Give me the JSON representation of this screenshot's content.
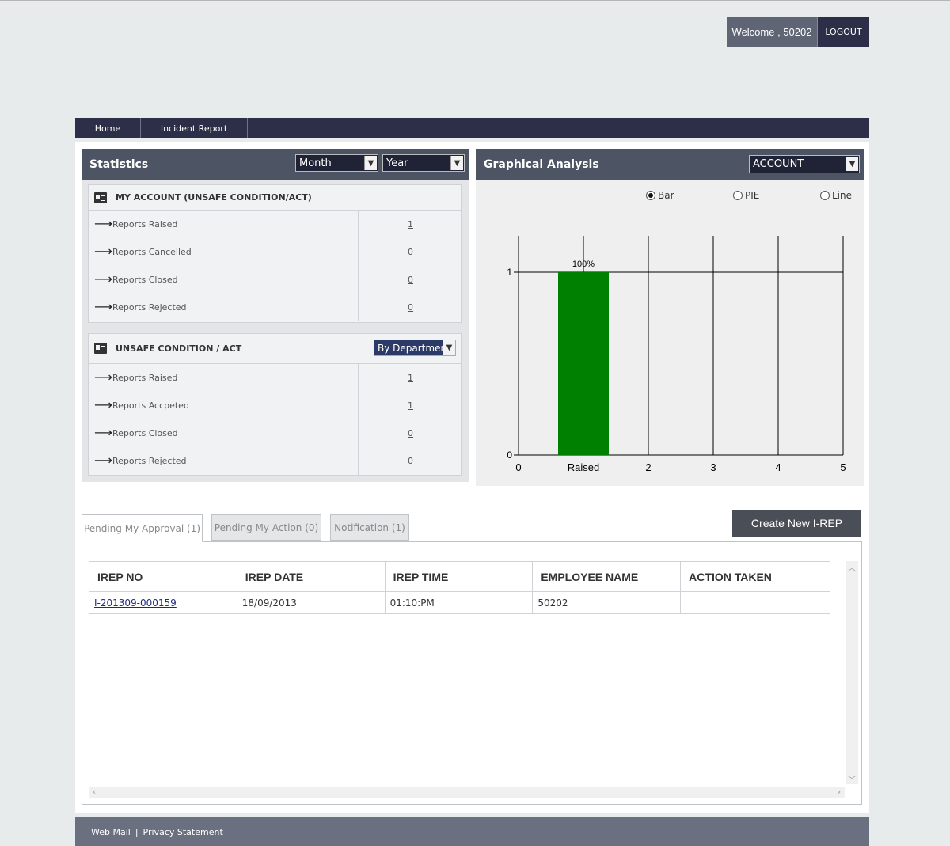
{
  "header": {
    "welcome": "Welcome , 50202",
    "logout": "LOGOUT"
  },
  "nav": {
    "items": [
      "Home",
      "Incident Report"
    ]
  },
  "statistics": {
    "title": "Statistics",
    "month_select": "Month",
    "year_select": "Year",
    "my_account": {
      "title": "MY ACCOUNT (UNSAFE CONDITION/ACT)",
      "rows": [
        {
          "label": "Reports Raised",
          "value": "1"
        },
        {
          "label": "Reports Cancelled",
          "value": "0"
        },
        {
          "label": "Reports Closed",
          "value": "0"
        },
        {
          "label": "Reports Rejected",
          "value": "0"
        }
      ]
    },
    "unsafe": {
      "title": "UNSAFE CONDITION / ACT",
      "dept_select": "By Department",
      "rows": [
        {
          "label": "Reports Raised",
          "value": "1"
        },
        {
          "label": "Reports Accpeted",
          "value": "1"
        },
        {
          "label": "Reports Closed",
          "value": "0"
        },
        {
          "label": "Reports Rejected",
          "value": "0"
        }
      ]
    }
  },
  "graph": {
    "title": "Graphical Analysis",
    "account_select": "ACCOUNT",
    "radio": {
      "bar": "Bar",
      "pie": "PIE",
      "line": "Line",
      "selected": "bar"
    },
    "bar_color": "#008000"
  },
  "chart_data": {
    "type": "bar",
    "categories": [
      "Raised"
    ],
    "values": [
      1
    ],
    "data_labels": [
      "100%"
    ],
    "x_ticks": [
      "0",
      "Raised",
      "2",
      "3",
      "4",
      "5"
    ],
    "y_ticks": [
      "0",
      "1"
    ],
    "ylim": [
      0,
      1
    ],
    "grid": true,
    "title": "",
    "xlabel": "",
    "ylabel": ""
  },
  "tabs": [
    {
      "label": "Pending My Approval (1)",
      "active": true
    },
    {
      "label": "Pending My Action (0)",
      "active": false
    },
    {
      "label": "Notification (1)",
      "active": false
    }
  ],
  "create_button": "Create New I-REP",
  "table": {
    "headers": [
      "IREP NO",
      "IREP DATE",
      "IREP TIME",
      "EMPLOYEE NAME",
      "ACTION TAKEN"
    ],
    "rows": [
      [
        "I-201309-000159",
        "18/09/2013",
        "01:10:PM",
        "50202",
        ""
      ]
    ]
  },
  "footer": {
    "webmail": "Web Mail",
    "separator": "|",
    "privacy": "Privacy Statement"
  }
}
